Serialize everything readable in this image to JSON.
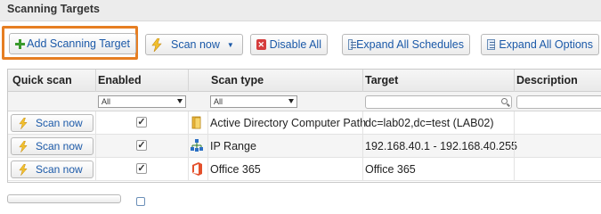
{
  "header": {
    "title": "Scanning Targets"
  },
  "toolbar": {
    "add_target_label": "Add Scanning Target",
    "scan_now_label": "Scan now",
    "disable_all_label": "Disable All",
    "expand_schedules_label": "Expand All Schedules",
    "expand_options_label": "Expand All Options"
  },
  "grid": {
    "columns": {
      "quick_scan": "Quick scan",
      "enabled": "Enabled",
      "scan_type": "Scan type",
      "target": "Target",
      "description": "Description"
    },
    "filters": {
      "enabled_value": "All",
      "scan_type_value": "All",
      "target_value": "",
      "description_value": ""
    },
    "rows": [
      {
        "scan_button": "Scan now",
        "enabled": true,
        "scan_type": "Active Directory Computer Path",
        "target": "dc=lab02,dc=test (LAB02)",
        "icon": "folder-icon"
      },
      {
        "scan_button": "Scan now",
        "enabled": true,
        "scan_type": "IP Range",
        "target": "192.168.40.1 - 192.168.40.255",
        "icon": "network-icon"
      },
      {
        "scan_button": "Scan now",
        "enabled": true,
        "scan_type": "Office 365",
        "target": "Office 365",
        "icon": "office365-icon"
      }
    ]
  },
  "colors": {
    "accent_link": "#1b59a8",
    "highlight_border": "#e67e22"
  }
}
